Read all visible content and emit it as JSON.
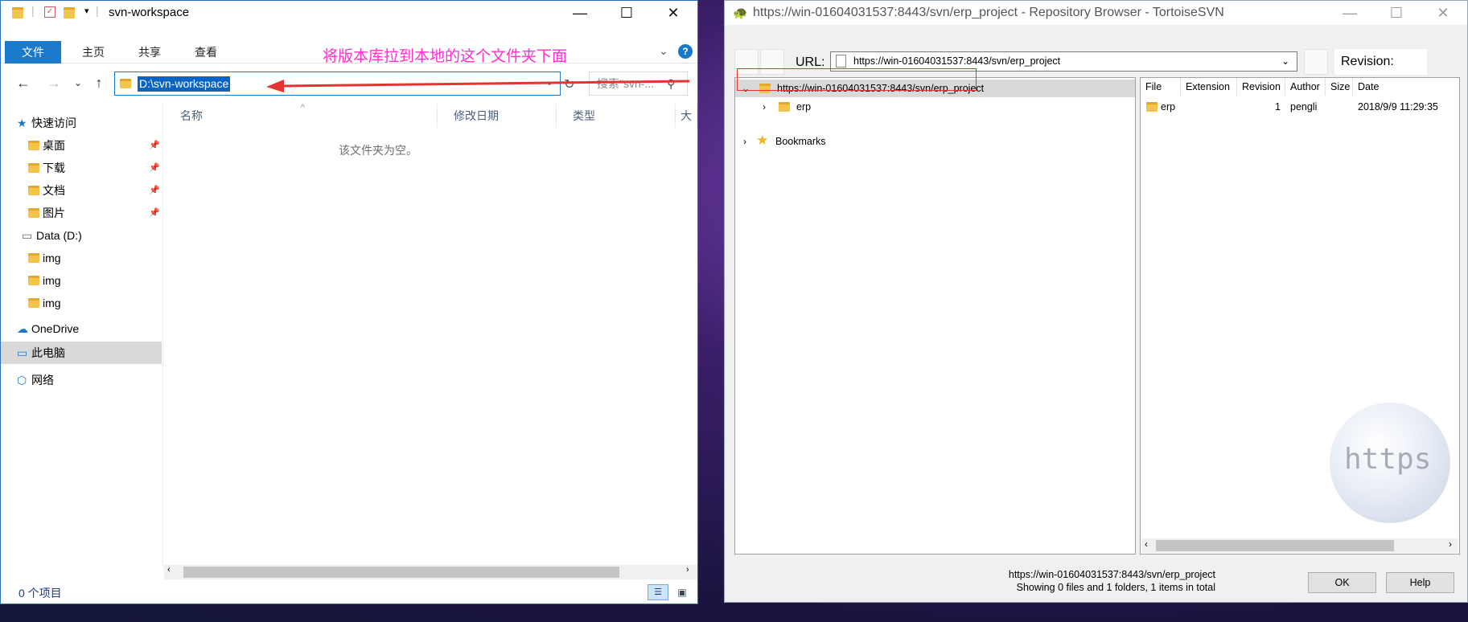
{
  "explorer": {
    "title": "svn-workspace",
    "ribbon_tabs": [
      "文件",
      "主页",
      "共享",
      "查看"
    ],
    "address_path": "D:\\svn-workspace",
    "search_placeholder": "搜索\"svn-...",
    "nav_items": [
      {
        "label": "快速访问",
        "icon": "star-icon"
      },
      {
        "label": "桌面",
        "icon": "folder-icon",
        "pinned": true
      },
      {
        "label": "下载",
        "icon": "download-folder-icon",
        "pinned": true
      },
      {
        "label": "文档",
        "icon": "document-folder-icon",
        "pinned": true
      },
      {
        "label": "图片",
        "icon": "picture-folder-icon",
        "pinned": true
      },
      {
        "label": "Data (D:)",
        "icon": "drive-icon"
      },
      {
        "label": "img",
        "icon": "folder-icon"
      },
      {
        "label": "img",
        "icon": "folder-icon"
      },
      {
        "label": "img",
        "icon": "folder-icon"
      },
      {
        "label": "OneDrive",
        "icon": "cloud-icon"
      },
      {
        "label": "此电脑",
        "icon": "computer-icon",
        "selected": true
      },
      {
        "label": "网络",
        "icon": "network-icon"
      }
    ],
    "columns": [
      "名称",
      "修改日期",
      "类型",
      "大"
    ],
    "empty_message": "该文件夹为空。",
    "status_count": "0 个项目",
    "annotation": "将版本库拉到本地的这个文件夹下面",
    "annotation_color": "#ff2fcf"
  },
  "svn": {
    "title": "https://win-01604031537:8443/svn/erp_project - Repository Browser - TortoiseSVN",
    "url_label": "URL:",
    "url_value": "https://win-01604031537:8443/svn/erp_project",
    "revision_label": "Revision:",
    "tree": {
      "root": "https://win-01604031537:8443/svn/erp_project",
      "child": "erp",
      "bookmarks": "Bookmarks"
    },
    "list_columns": [
      "File",
      "Extension",
      "Revision",
      "Author",
      "Size",
      "Date"
    ],
    "rows": [
      {
        "file": "erp",
        "extension": "",
        "revision": "1",
        "author": "pengli",
        "size": "",
        "date": "2018/9/9 11:29:35"
      }
    ],
    "status_line1": "https://win-01604031537:8443/svn/erp_project",
    "status_line2": "Showing 0 files and 1 folders, 1 items in total",
    "ok_label": "OK",
    "help_label": "Help",
    "watermark": "https"
  }
}
